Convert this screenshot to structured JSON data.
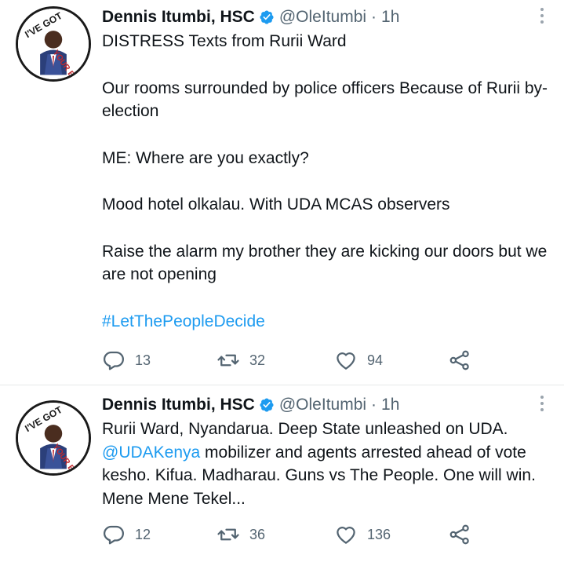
{
  "tweets": [
    {
      "author": {
        "name": "Dennis Itumbi, HSC",
        "handle": "@OleItumbi",
        "time": "1h",
        "separator": "·"
      },
      "avatar_text": [
        "I'VE GOT",
        "YOUR BACK"
      ],
      "paragraphs": [
        "DISTRESS Texts from Rurii Ward",
        "Our rooms surrounded by police officers Because of Rurii by-election",
        "ME: Where are you exactly?",
        "Mood hotel olkalau. With UDA MCAS observers",
        "Raise the alarm my brother they are kicking our doors but we are not opening"
      ],
      "hashtag": "#LetThePeopleDecide",
      "stats": {
        "replies": "13",
        "retweets": "32",
        "likes": "94"
      }
    },
    {
      "author": {
        "name": "Dennis Itumbi, HSC",
        "handle": "@OleItumbi",
        "time": "1h",
        "separator": "·"
      },
      "avatar_text": [
        "I'VE GOT",
        "YOUR BACK"
      ],
      "text_before_mention": "Rurii Ward, Nyandarua. Deep State unleashed on UDA.",
      "mention": "@UDAKenya",
      "text_after_mention": " mobilizer and agents arrested ahead of vote kesho. Kifua. Madharau. Guns vs The People. One will win. Mene Mene Tekel...",
      "stats": {
        "replies": "12",
        "retweets": "36",
        "likes": "136"
      }
    }
  ],
  "colors": {
    "link": "#1d9bf0",
    "verified": "#1d9bf0",
    "muted": "#536471",
    "text": "#0f1419"
  },
  "icons": [
    "verified-badge-icon",
    "more-icon",
    "reply-icon",
    "retweet-icon",
    "like-icon",
    "share-icon"
  ]
}
